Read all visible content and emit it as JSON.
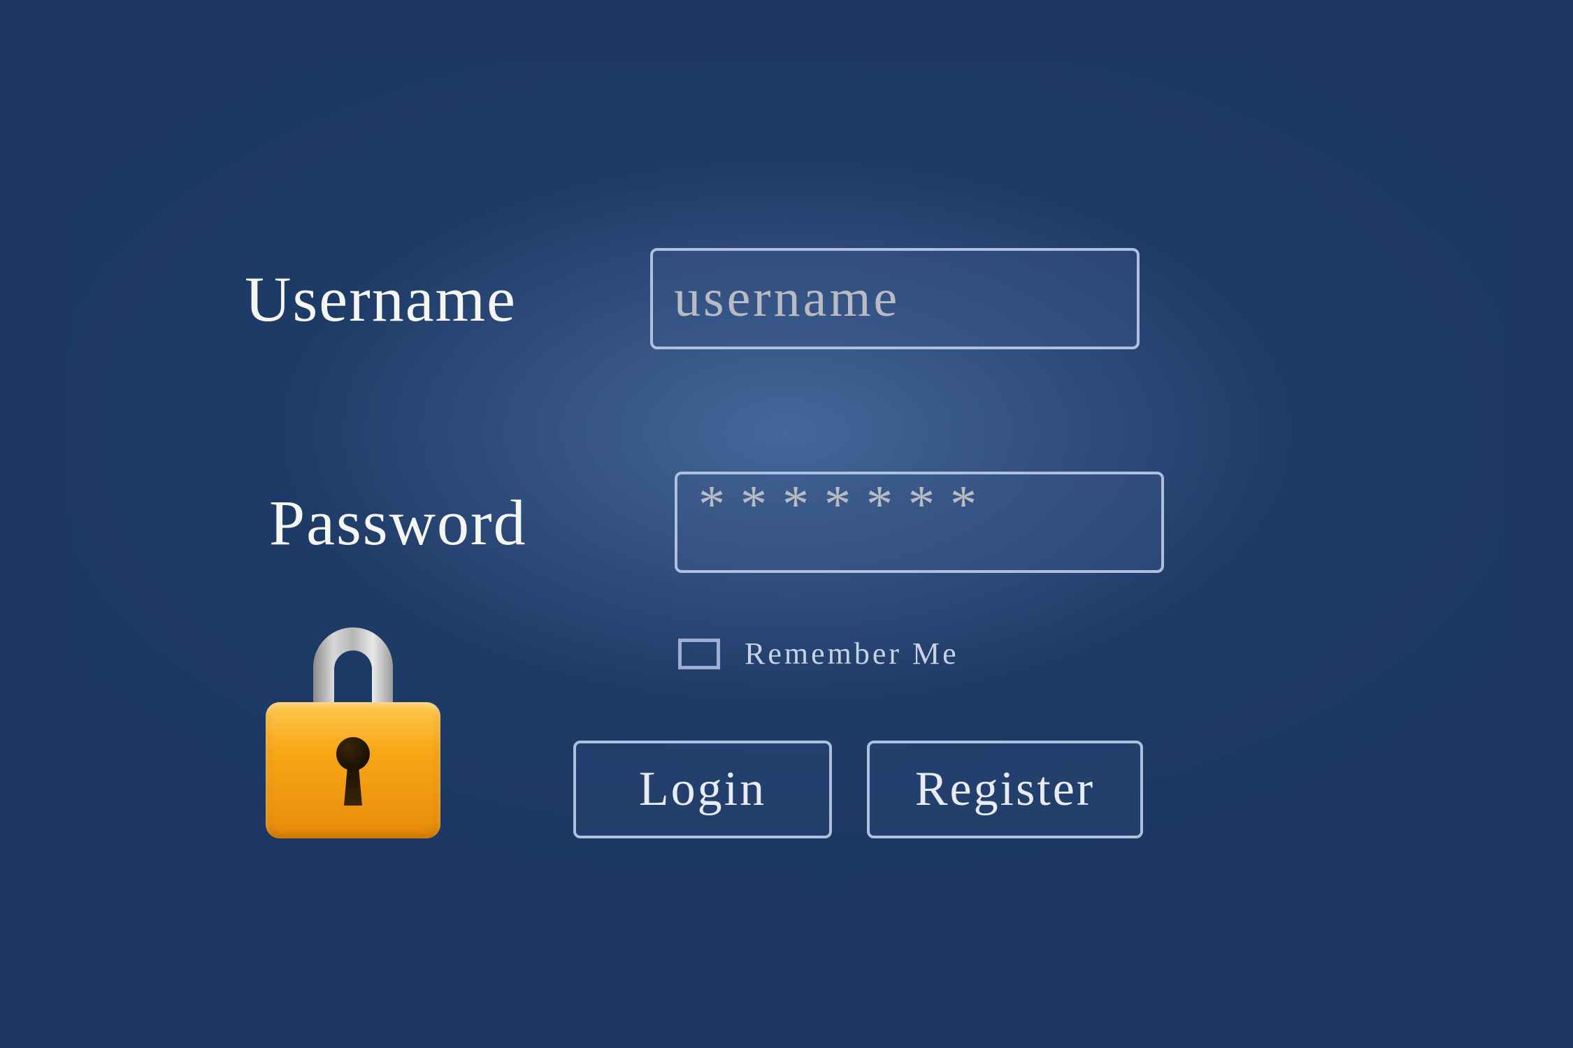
{
  "form": {
    "username_label": "Username",
    "username_placeholder": "username",
    "username_value": "",
    "password_label": "Password",
    "password_display": "*******",
    "remember_label": "Remember Me",
    "login_button": "Login",
    "register_button": "Register"
  }
}
